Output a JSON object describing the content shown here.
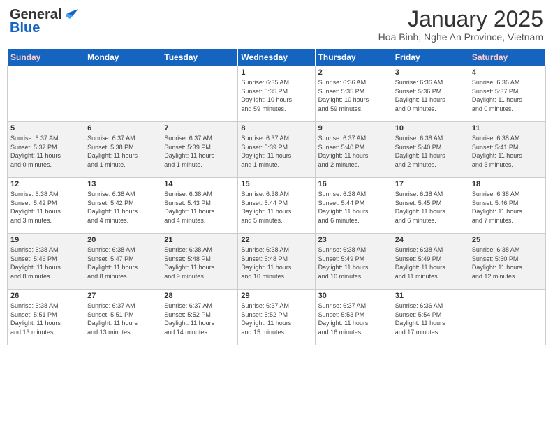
{
  "header": {
    "logo_line1": "General",
    "logo_line2": "Blue",
    "month": "January 2025",
    "location": "Hoa Binh, Nghe An Province, Vietnam"
  },
  "days_of_week": [
    "Sunday",
    "Monday",
    "Tuesday",
    "Wednesday",
    "Thursday",
    "Friday",
    "Saturday"
  ],
  "weeks": [
    {
      "days": [
        {
          "num": "",
          "info": ""
        },
        {
          "num": "",
          "info": ""
        },
        {
          "num": "",
          "info": ""
        },
        {
          "num": "1",
          "info": "Sunrise: 6:35 AM\nSunset: 5:35 PM\nDaylight: 10 hours\nand 59 minutes."
        },
        {
          "num": "2",
          "info": "Sunrise: 6:36 AM\nSunset: 5:35 PM\nDaylight: 10 hours\nand 59 minutes."
        },
        {
          "num": "3",
          "info": "Sunrise: 6:36 AM\nSunset: 5:36 PM\nDaylight: 11 hours\nand 0 minutes."
        },
        {
          "num": "4",
          "info": "Sunrise: 6:36 AM\nSunset: 5:37 PM\nDaylight: 11 hours\nand 0 minutes."
        }
      ]
    },
    {
      "days": [
        {
          "num": "5",
          "info": "Sunrise: 6:37 AM\nSunset: 5:37 PM\nDaylight: 11 hours\nand 0 minutes."
        },
        {
          "num": "6",
          "info": "Sunrise: 6:37 AM\nSunset: 5:38 PM\nDaylight: 11 hours\nand 1 minute."
        },
        {
          "num": "7",
          "info": "Sunrise: 6:37 AM\nSunset: 5:39 PM\nDaylight: 11 hours\nand 1 minute."
        },
        {
          "num": "8",
          "info": "Sunrise: 6:37 AM\nSunset: 5:39 PM\nDaylight: 11 hours\nand 1 minute."
        },
        {
          "num": "9",
          "info": "Sunrise: 6:37 AM\nSunset: 5:40 PM\nDaylight: 11 hours\nand 2 minutes."
        },
        {
          "num": "10",
          "info": "Sunrise: 6:38 AM\nSunset: 5:40 PM\nDaylight: 11 hours\nand 2 minutes."
        },
        {
          "num": "11",
          "info": "Sunrise: 6:38 AM\nSunset: 5:41 PM\nDaylight: 11 hours\nand 3 minutes."
        }
      ]
    },
    {
      "days": [
        {
          "num": "12",
          "info": "Sunrise: 6:38 AM\nSunset: 5:42 PM\nDaylight: 11 hours\nand 3 minutes."
        },
        {
          "num": "13",
          "info": "Sunrise: 6:38 AM\nSunset: 5:42 PM\nDaylight: 11 hours\nand 4 minutes."
        },
        {
          "num": "14",
          "info": "Sunrise: 6:38 AM\nSunset: 5:43 PM\nDaylight: 11 hours\nand 4 minutes."
        },
        {
          "num": "15",
          "info": "Sunrise: 6:38 AM\nSunset: 5:44 PM\nDaylight: 11 hours\nand 5 minutes."
        },
        {
          "num": "16",
          "info": "Sunrise: 6:38 AM\nSunset: 5:44 PM\nDaylight: 11 hours\nand 6 minutes."
        },
        {
          "num": "17",
          "info": "Sunrise: 6:38 AM\nSunset: 5:45 PM\nDaylight: 11 hours\nand 6 minutes."
        },
        {
          "num": "18",
          "info": "Sunrise: 6:38 AM\nSunset: 5:46 PM\nDaylight: 11 hours\nand 7 minutes."
        }
      ]
    },
    {
      "days": [
        {
          "num": "19",
          "info": "Sunrise: 6:38 AM\nSunset: 5:46 PM\nDaylight: 11 hours\nand 8 minutes."
        },
        {
          "num": "20",
          "info": "Sunrise: 6:38 AM\nSunset: 5:47 PM\nDaylight: 11 hours\nand 8 minutes."
        },
        {
          "num": "21",
          "info": "Sunrise: 6:38 AM\nSunset: 5:48 PM\nDaylight: 11 hours\nand 9 minutes."
        },
        {
          "num": "22",
          "info": "Sunrise: 6:38 AM\nSunset: 5:48 PM\nDaylight: 11 hours\nand 10 minutes."
        },
        {
          "num": "23",
          "info": "Sunrise: 6:38 AM\nSunset: 5:49 PM\nDaylight: 11 hours\nand 10 minutes."
        },
        {
          "num": "24",
          "info": "Sunrise: 6:38 AM\nSunset: 5:49 PM\nDaylight: 11 hours\nand 11 minutes."
        },
        {
          "num": "25",
          "info": "Sunrise: 6:38 AM\nSunset: 5:50 PM\nDaylight: 11 hours\nand 12 minutes."
        }
      ]
    },
    {
      "days": [
        {
          "num": "26",
          "info": "Sunrise: 6:38 AM\nSunset: 5:51 PM\nDaylight: 11 hours\nand 13 minutes."
        },
        {
          "num": "27",
          "info": "Sunrise: 6:37 AM\nSunset: 5:51 PM\nDaylight: 11 hours\nand 13 minutes."
        },
        {
          "num": "28",
          "info": "Sunrise: 6:37 AM\nSunset: 5:52 PM\nDaylight: 11 hours\nand 14 minutes."
        },
        {
          "num": "29",
          "info": "Sunrise: 6:37 AM\nSunset: 5:52 PM\nDaylight: 11 hours\nand 15 minutes."
        },
        {
          "num": "30",
          "info": "Sunrise: 6:37 AM\nSunset: 5:53 PM\nDaylight: 11 hours\nand 16 minutes."
        },
        {
          "num": "31",
          "info": "Sunrise: 6:36 AM\nSunset: 5:54 PM\nDaylight: 11 hours\nand 17 minutes."
        },
        {
          "num": "",
          "info": ""
        }
      ]
    }
  ]
}
